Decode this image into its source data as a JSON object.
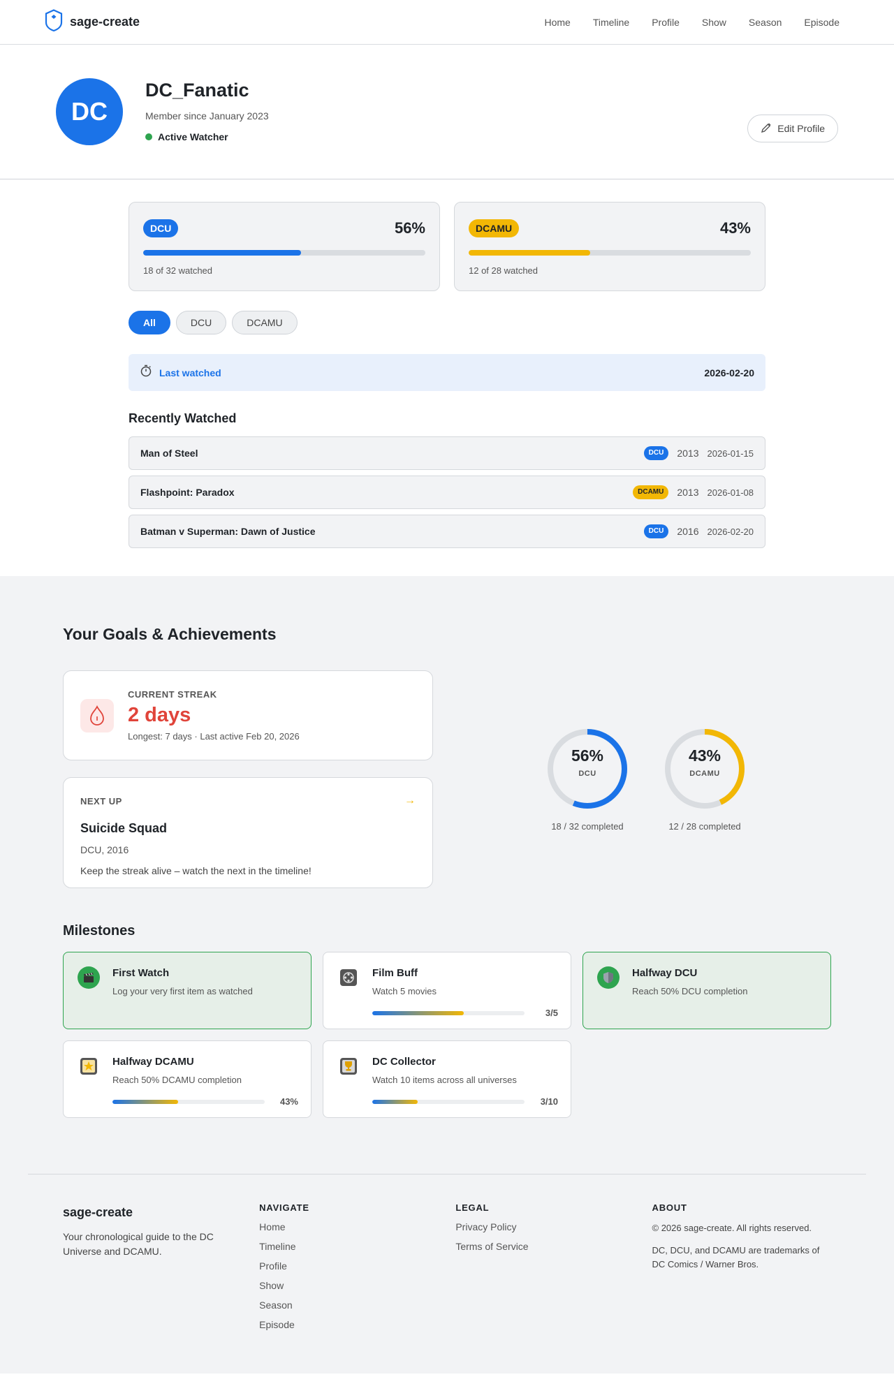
{
  "header": {
    "brand": "sage-create",
    "nav": [
      "Home",
      "Timeline",
      "Profile",
      "Show",
      "Season",
      "Episode"
    ]
  },
  "profile": {
    "avatar_initials": "DC",
    "username": "DC_Fanatic",
    "member_since": "Member since January 2023",
    "status": "Active Watcher",
    "edit_label": "Edit Profile"
  },
  "progress": [
    {
      "badge": "DCU",
      "percent_label": "56%",
      "percent": 56,
      "watched": "18 of 32 watched",
      "color": "#1b73e8"
    },
    {
      "badge": "DCAMU",
      "percent_label": "43%",
      "percent": 43,
      "watched": "12 of 28 watched",
      "color": "#f2b705"
    }
  ],
  "filters": [
    "All",
    "DCU",
    "DCAMU"
  ],
  "last_watched": {
    "label": "Last watched",
    "date": "2026-02-20"
  },
  "recently_watched": {
    "title": "Recently Watched",
    "items": [
      {
        "title": "Man of Steel",
        "universe": "DCU",
        "year": "2013",
        "date": "2026-01-15"
      },
      {
        "title": "Flashpoint: Paradox",
        "universe": "DCAMU",
        "year": "2013",
        "date": "2026-01-08"
      },
      {
        "title": "Batman v Superman: Dawn of Justice",
        "universe": "DCU",
        "year": "2016",
        "date": "2026-02-20"
      }
    ]
  },
  "goals": {
    "title": "Your Goals & Achievements",
    "streak": {
      "label": "CURRENT STREAK",
      "value": "2 days",
      "sub": "Longest: 7 days · Last active Feb 20, 2026"
    },
    "next_up": {
      "label": "NEXT UP",
      "arrow": "→",
      "title": "Suicide Squad",
      "meta": "DCU, 2016",
      "note": "Keep the streak alive – watch the next in the timeline!"
    },
    "rings": [
      {
        "pct_label": "56%",
        "percent": 56,
        "label": "DCU",
        "sub": "18 / 32 completed",
        "color": "#1b73e8"
      },
      {
        "pct_label": "43%",
        "percent": 43,
        "label": "DCAMU",
        "sub": "12 / 28 completed",
        "color": "#f2b705"
      }
    ]
  },
  "milestones": {
    "title": "Milestones",
    "items": [
      {
        "name": "First Watch",
        "desc": "Log your very first item as watched",
        "done": true,
        "icon": "clapperboard-icon"
      },
      {
        "name": "Film Buff",
        "desc": "Watch 5 movies",
        "done": false,
        "count": "3/5",
        "progress": 0.6,
        "icon": "film-reel-icon"
      },
      {
        "name": "Halfway DCU",
        "desc": "Reach 50% DCU completion",
        "done": true,
        "icon": "shield-icon"
      },
      {
        "name": "Halfway DCAMU",
        "desc": "Reach 50% DCAMU completion",
        "done": false,
        "count": "43%",
        "progress": 0.43,
        "icon": "star-icon"
      },
      {
        "name": "DC Collector",
        "desc": "Watch 10 items across all universes",
        "done": false,
        "count": "3/10",
        "progress": 0.3,
        "icon": "trophy-icon"
      }
    ]
  },
  "footer": {
    "brand": "sage-create",
    "tagline": "Your chronological guide to the DC Universe and DCAMU.",
    "navigate": {
      "head": "NAVIGATE",
      "links": [
        "Home",
        "Timeline",
        "Profile",
        "Show",
        "Season",
        "Episode"
      ]
    },
    "legal": {
      "head": "LEGAL",
      "links": [
        "Privacy Policy",
        "Terms of Service"
      ]
    },
    "about": {
      "head": "ABOUT",
      "copyright": "© 2026 sage-create. All rights reserved.",
      "trademark": "DC, DCU, and DCAMU are trademarks of DC Comics / Warner Bros."
    }
  }
}
